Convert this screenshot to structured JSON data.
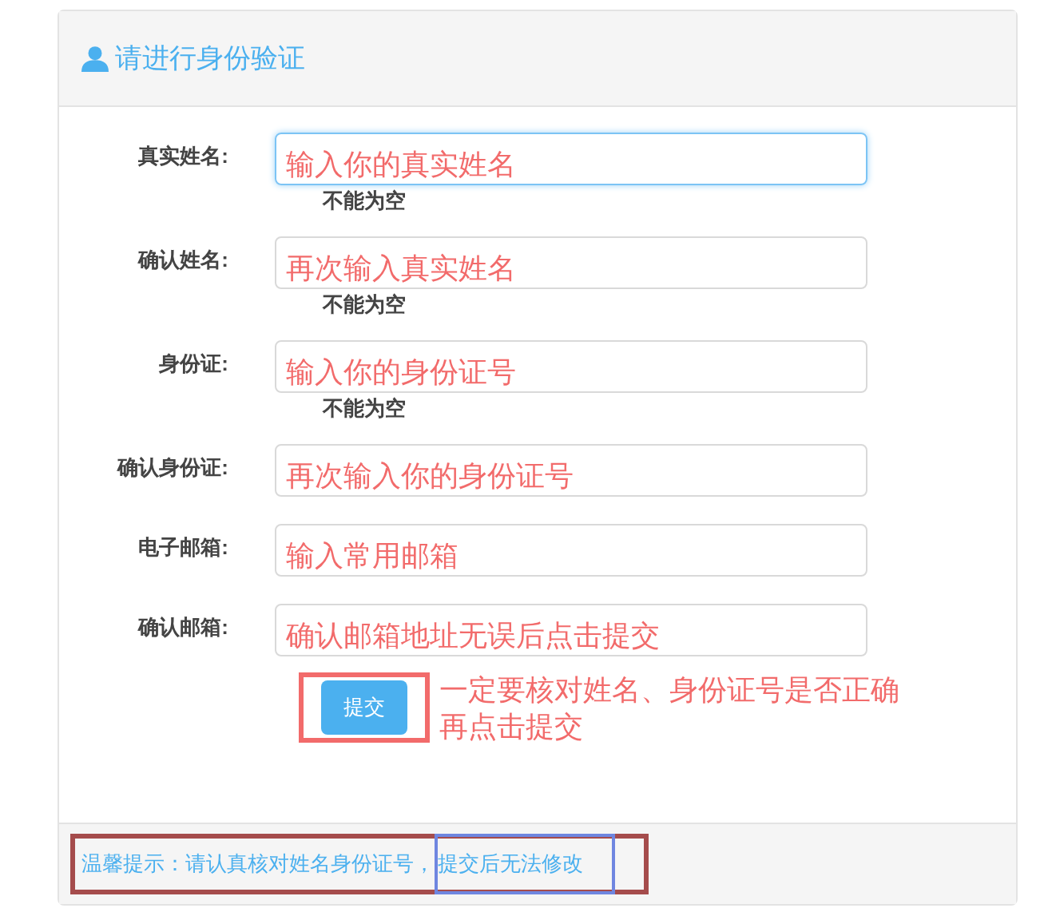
{
  "panel": {
    "title": "请进行身份验证"
  },
  "fields": [
    {
      "label": "真实姓名:",
      "placeholder": "输入你的真实姓名",
      "focused": true,
      "error": "不能为空"
    },
    {
      "label": "确认姓名:",
      "placeholder": "再次输入真实姓名",
      "focused": false,
      "error": "不能为空"
    },
    {
      "label": "身份证:",
      "placeholder": "输入你的身份证号",
      "focused": false,
      "error": "不能为空"
    },
    {
      "label": "确认身份证:",
      "placeholder": "再次输入你的身份证号",
      "focused": false
    },
    {
      "label": "电子邮箱:",
      "placeholder": "输入常用邮箱",
      "focused": false
    },
    {
      "label": "确认邮箱:",
      "placeholder": "确认邮箱地址无误后点击提交",
      "focused": false
    }
  ],
  "submit": {
    "label": "提交",
    "note_lines": [
      "一定要核对姓名、身份证号是否正确",
      "再点击提交"
    ]
  },
  "footer": {
    "tip": "温馨提示：请认真核对姓名身份证号，",
    "highlighted": "提交后无法修改"
  }
}
